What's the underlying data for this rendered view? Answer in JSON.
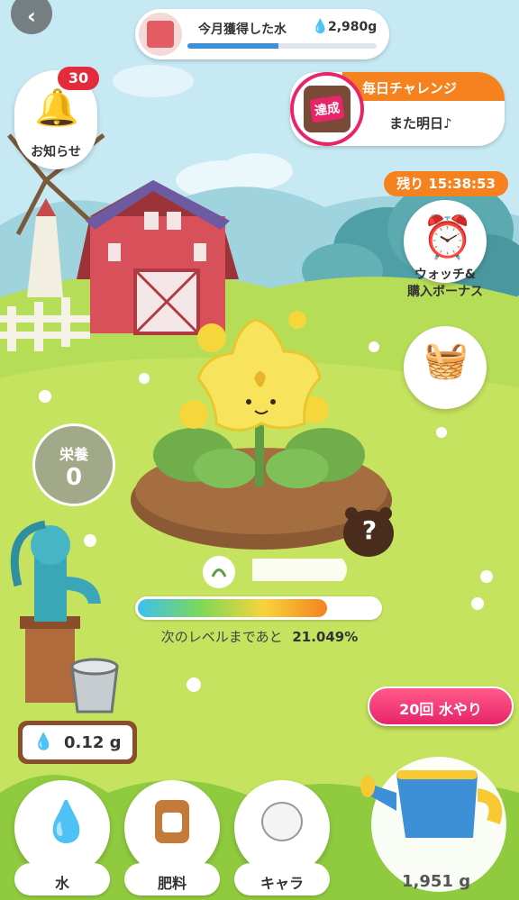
{
  "header": {
    "water_label": "今月獲得した水",
    "water_value": "2,980g",
    "water_progress": 0.48
  },
  "notifications": {
    "label": "お知らせ",
    "badge": "30"
  },
  "daily_challenge": {
    "title": "毎日チャレンジ",
    "stamp": "達成",
    "status": "また明日♪"
  },
  "watch_bonus": {
    "timer": "残り 15:38:53",
    "label_line1": "ウォッチ&",
    "label_line2": "購入ボーナス"
  },
  "nutrition": {
    "label": "栄養",
    "value": "0"
  },
  "mystery": {
    "symbol": "?"
  },
  "level": {
    "prefix": "次のレベルまであと",
    "percent": "21.049%",
    "progress": 0.79
  },
  "tank": {
    "amount": "0.12 g"
  },
  "watering_button": {
    "label": "20回 水やり"
  },
  "can": {
    "amount": "1,951 g"
  },
  "bottom_nav": {
    "water": "水",
    "fertilizer": "肥料",
    "character": "キャラ"
  },
  "colors": {
    "accent_orange": "#f5821f",
    "accent_pink": "#e8246a",
    "sky": "#bfe6f2",
    "grass": "#a8d94a"
  }
}
